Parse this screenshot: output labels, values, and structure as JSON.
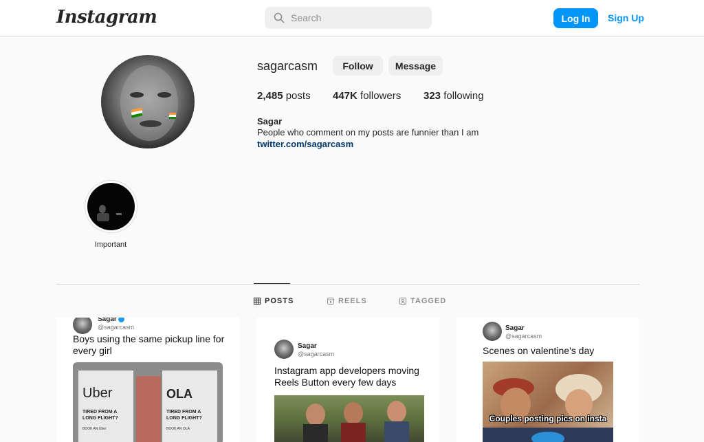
{
  "header": {
    "logo": "Instagram",
    "search_placeholder": "Search",
    "login_label": "Log In",
    "signup_label": "Sign Up"
  },
  "profile": {
    "username": "sagarcasm",
    "follow_label": "Follow",
    "message_label": "Message",
    "posts_count": "2,485",
    "posts_label": "posts",
    "followers_count": "447K",
    "followers_label": "followers",
    "following_count": "323",
    "following_label": "following",
    "full_name": "Sagar",
    "bio": "People who comment on my posts are funnier than I am",
    "link": "twitter.com/sagarcasm"
  },
  "highlights": [
    {
      "label": "Important"
    }
  ],
  "tabs": [
    {
      "label": "POSTS",
      "icon": "grid-icon",
      "active": true
    },
    {
      "label": "REELS",
      "icon": "reels-icon",
      "active": false
    },
    {
      "label": "TAGGED",
      "icon": "tagged-icon",
      "active": false
    }
  ],
  "posts": [
    {
      "name": "Sagar",
      "handle": "@sagarcasm",
      "text": "Boys using the same pickup line for every girl",
      "image_text_left": "Uber",
      "image_sub_left": "TIRED FROM A LONG FLIGHT?",
      "image_book_left": "BOOK AN Uber",
      "image_text_right": "OLA",
      "image_sub_right": "TIRED FROM A LONG FLIGHT?",
      "image_book_right": "BOOK AN OLA"
    },
    {
      "name": "Sagar",
      "handle": "@sagarcasm",
      "text": "Instagram app developers moving Reels Button every few days"
    },
    {
      "name": "Sagar",
      "handle": "@sagarcasm",
      "text": "Scenes on valentine's day",
      "image_caption": "Couples posting pics on insta"
    }
  ]
}
